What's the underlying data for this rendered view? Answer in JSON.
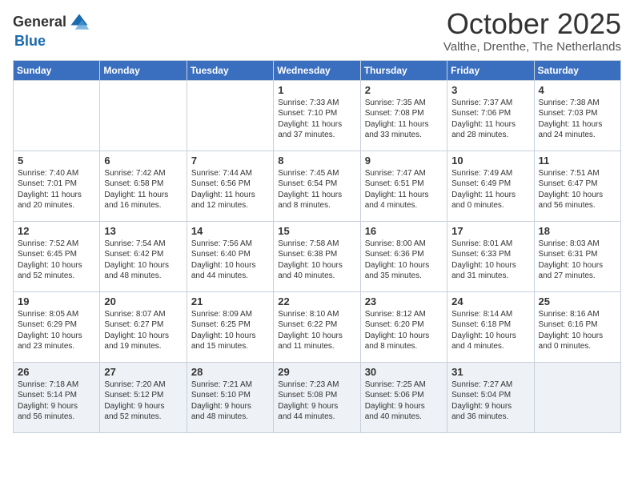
{
  "header": {
    "logo_general": "General",
    "logo_blue": "Blue",
    "month": "October 2025",
    "location": "Valthe, Drenthe, The Netherlands"
  },
  "weekdays": [
    "Sunday",
    "Monday",
    "Tuesday",
    "Wednesday",
    "Thursday",
    "Friday",
    "Saturday"
  ],
  "weeks": [
    [
      {
        "day": "",
        "text": ""
      },
      {
        "day": "",
        "text": ""
      },
      {
        "day": "",
        "text": ""
      },
      {
        "day": "1",
        "text": "Sunrise: 7:33 AM\nSunset: 7:10 PM\nDaylight: 11 hours\nand 37 minutes."
      },
      {
        "day": "2",
        "text": "Sunrise: 7:35 AM\nSunset: 7:08 PM\nDaylight: 11 hours\nand 33 minutes."
      },
      {
        "day": "3",
        "text": "Sunrise: 7:37 AM\nSunset: 7:06 PM\nDaylight: 11 hours\nand 28 minutes."
      },
      {
        "day": "4",
        "text": "Sunrise: 7:38 AM\nSunset: 7:03 PM\nDaylight: 11 hours\nand 24 minutes."
      }
    ],
    [
      {
        "day": "5",
        "text": "Sunrise: 7:40 AM\nSunset: 7:01 PM\nDaylight: 11 hours\nand 20 minutes."
      },
      {
        "day": "6",
        "text": "Sunrise: 7:42 AM\nSunset: 6:58 PM\nDaylight: 11 hours\nand 16 minutes."
      },
      {
        "day": "7",
        "text": "Sunrise: 7:44 AM\nSunset: 6:56 PM\nDaylight: 11 hours\nand 12 minutes."
      },
      {
        "day": "8",
        "text": "Sunrise: 7:45 AM\nSunset: 6:54 PM\nDaylight: 11 hours\nand 8 minutes."
      },
      {
        "day": "9",
        "text": "Sunrise: 7:47 AM\nSunset: 6:51 PM\nDaylight: 11 hours\nand 4 minutes."
      },
      {
        "day": "10",
        "text": "Sunrise: 7:49 AM\nSunset: 6:49 PM\nDaylight: 11 hours\nand 0 minutes."
      },
      {
        "day": "11",
        "text": "Sunrise: 7:51 AM\nSunset: 6:47 PM\nDaylight: 10 hours\nand 56 minutes."
      }
    ],
    [
      {
        "day": "12",
        "text": "Sunrise: 7:52 AM\nSunset: 6:45 PM\nDaylight: 10 hours\nand 52 minutes."
      },
      {
        "day": "13",
        "text": "Sunrise: 7:54 AM\nSunset: 6:42 PM\nDaylight: 10 hours\nand 48 minutes."
      },
      {
        "day": "14",
        "text": "Sunrise: 7:56 AM\nSunset: 6:40 PM\nDaylight: 10 hours\nand 44 minutes."
      },
      {
        "day": "15",
        "text": "Sunrise: 7:58 AM\nSunset: 6:38 PM\nDaylight: 10 hours\nand 40 minutes."
      },
      {
        "day": "16",
        "text": "Sunrise: 8:00 AM\nSunset: 6:36 PM\nDaylight: 10 hours\nand 35 minutes."
      },
      {
        "day": "17",
        "text": "Sunrise: 8:01 AM\nSunset: 6:33 PM\nDaylight: 10 hours\nand 31 minutes."
      },
      {
        "day": "18",
        "text": "Sunrise: 8:03 AM\nSunset: 6:31 PM\nDaylight: 10 hours\nand 27 minutes."
      }
    ],
    [
      {
        "day": "19",
        "text": "Sunrise: 8:05 AM\nSunset: 6:29 PM\nDaylight: 10 hours\nand 23 minutes."
      },
      {
        "day": "20",
        "text": "Sunrise: 8:07 AM\nSunset: 6:27 PM\nDaylight: 10 hours\nand 19 minutes."
      },
      {
        "day": "21",
        "text": "Sunrise: 8:09 AM\nSunset: 6:25 PM\nDaylight: 10 hours\nand 15 minutes."
      },
      {
        "day": "22",
        "text": "Sunrise: 8:10 AM\nSunset: 6:22 PM\nDaylight: 10 hours\nand 11 minutes."
      },
      {
        "day": "23",
        "text": "Sunrise: 8:12 AM\nSunset: 6:20 PM\nDaylight: 10 hours\nand 8 minutes."
      },
      {
        "day": "24",
        "text": "Sunrise: 8:14 AM\nSunset: 6:18 PM\nDaylight: 10 hours\nand 4 minutes."
      },
      {
        "day": "25",
        "text": "Sunrise: 8:16 AM\nSunset: 6:16 PM\nDaylight: 10 hours\nand 0 minutes."
      }
    ],
    [
      {
        "day": "26",
        "text": "Sunrise: 7:18 AM\nSunset: 5:14 PM\nDaylight: 9 hours\nand 56 minutes."
      },
      {
        "day": "27",
        "text": "Sunrise: 7:20 AM\nSunset: 5:12 PM\nDaylight: 9 hours\nand 52 minutes."
      },
      {
        "day": "28",
        "text": "Sunrise: 7:21 AM\nSunset: 5:10 PM\nDaylight: 9 hours\nand 48 minutes."
      },
      {
        "day": "29",
        "text": "Sunrise: 7:23 AM\nSunset: 5:08 PM\nDaylight: 9 hours\nand 44 minutes."
      },
      {
        "day": "30",
        "text": "Sunrise: 7:25 AM\nSunset: 5:06 PM\nDaylight: 9 hours\nand 40 minutes."
      },
      {
        "day": "31",
        "text": "Sunrise: 7:27 AM\nSunset: 5:04 PM\nDaylight: 9 hours\nand 36 minutes."
      },
      {
        "day": "",
        "text": ""
      }
    ]
  ]
}
